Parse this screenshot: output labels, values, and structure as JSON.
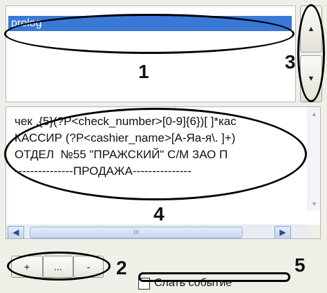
{
  "list": {
    "items": [
      "prolog"
    ]
  },
  "buttons": {
    "up_symbol": "▲",
    "down_symbol": "▼",
    "add_label": "+",
    "more_label": "...",
    "remove_label": "-"
  },
  "editor": {
    "lines": [
      "чек .{5}(?P<check_number>[0-9]{6})[ ]*кас",
      "КАССИР (?P<cashier_name>[А-Яа-я\\. ]+)",
      "ОТДЕЛ  №55 \"ПРАЖСКИЙ\" С/М ЗАО П",
      "---------------ПРОДАЖА---------------"
    ],
    "scroll_left": "◀",
    "scroll_right": "▶",
    "scroll_up": "▲",
    "scroll_down": "▼",
    "thumb_grip": "III"
  },
  "send_event": {
    "label": "Слать событие",
    "checked": false
  },
  "annotations": {
    "n1": "1",
    "n2": "2",
    "n3": "3",
    "n4": "4",
    "n5": "5"
  }
}
